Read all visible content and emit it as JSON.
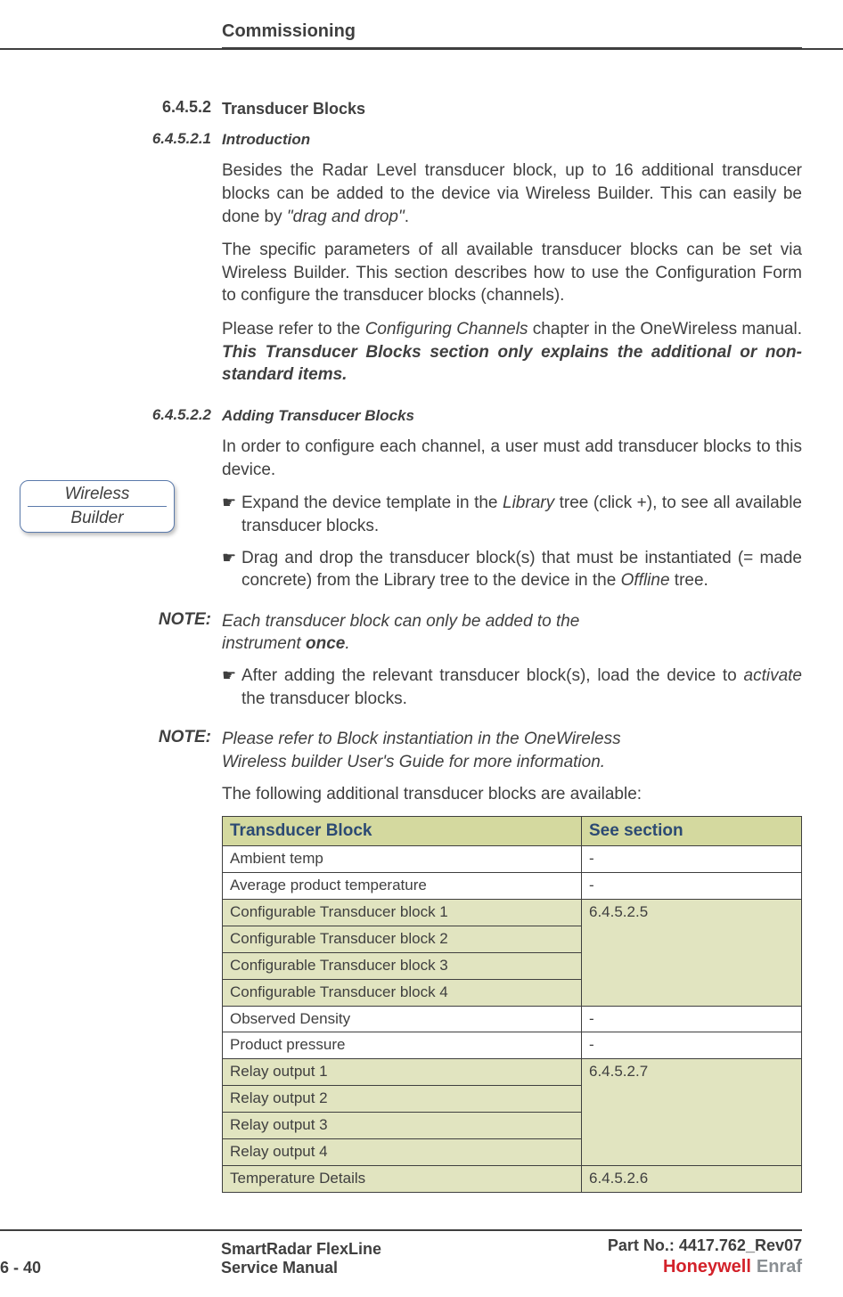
{
  "header": {
    "title": "Commissioning"
  },
  "callout": {
    "line1": "Wireless",
    "line2": "Builder"
  },
  "sections": {
    "s1": {
      "num": "6.4.5.2",
      "title": "Transducer Blocks"
    },
    "s1_1": {
      "num": "6.4.5.2.1",
      "title": "Introduction"
    },
    "s1_2": {
      "num": "6.4.5.2.2",
      "title": "Adding Transducer Blocks"
    }
  },
  "paras": {
    "p1a": "Besides the Radar Level transducer block, up to 16 additional transducer blocks can be added to the device via Wireless Builder. This can easily be done by ",
    "p1b": "\"drag and drop\"",
    "p1c": ".",
    "p2": "The specific parameters of all available transducer blocks can be set via Wireless Builder. This section describes how to use the Configuration Form to configure the transducer blocks (channels).",
    "p3a": "Please refer to the ",
    "p3b": "Configuring Channels",
    "p3c": " chapter in the OneWireless manual. ",
    "p3d": "This Transducer Blocks section only explains the additional or non-standard items.",
    "p4": "In order to configure each channel, a user must add transducer blocks to this device.",
    "b1a": "Expand the device template in the ",
    "b1b": "Library",
    "b1c": " tree (click +), to see all available transducer blocks.",
    "b2a": "Drag and drop the transducer block(s) that must be instantiated (= made concrete) from the Library tree to the device in the ",
    "b2b": "Offline",
    "b2c": " tree.",
    "note1_label": "NOTE:",
    "note1a": "Each transducer block can only be added to the instrument ",
    "note1b": "once",
    "note1c": ".",
    "b3a": "After adding the relevant transducer block(s), load the device to ",
    "b3b": "activate",
    "b3c": " the transducer blocks.",
    "note2_label": "NOTE:",
    "note2": "Please refer to Block instantiation in the OneWireless Wireless builder User's Guide for more information.",
    "p5": "The following additional transducer blocks are available:"
  },
  "table": {
    "headers": [
      "Transducer Block",
      "See section"
    ],
    "rows": [
      {
        "c0": "Ambient temp",
        "c1": "-",
        "hl": false
      },
      {
        "c0": "Average product temperature",
        "c1": "-",
        "hl": false
      },
      {
        "c0": "Configurable Transducer block 1",
        "c1": "6.4.5.2.5",
        "hl": true,
        "rowspan": 4
      },
      {
        "c0": "Configurable Transducer block 2",
        "hl": true,
        "merged": true
      },
      {
        "c0": "Configurable Transducer block 3",
        "hl": true,
        "merged": true
      },
      {
        "c0": "Configurable Transducer block 4",
        "hl": true,
        "merged": true
      },
      {
        "c0": "Observed Density",
        "c1": "-",
        "hl": false
      },
      {
        "c0": "Product pressure",
        "c1": "-",
        "hl": false
      },
      {
        "c0": "Relay output 1",
        "c1": "6.4.5.2.7",
        "hl": true,
        "rowspan": 4
      },
      {
        "c0": "Relay output 2",
        "hl": true,
        "merged": true
      },
      {
        "c0": "Relay output 3",
        "hl": true,
        "merged": true
      },
      {
        "c0": "Relay output 4",
        "hl": true,
        "merged": true
      },
      {
        "c0": "Temperature Details",
        "c1": "6.4.5.2.6",
        "hl": true
      }
    ]
  },
  "footer": {
    "page": "6 - 40",
    "mid1": "SmartRadar FlexLine",
    "mid2": "Service Manual",
    "right": "Part No.: 4417.762_Rev07",
    "brand1": "Honeywell",
    "brand2": "Enraf"
  }
}
